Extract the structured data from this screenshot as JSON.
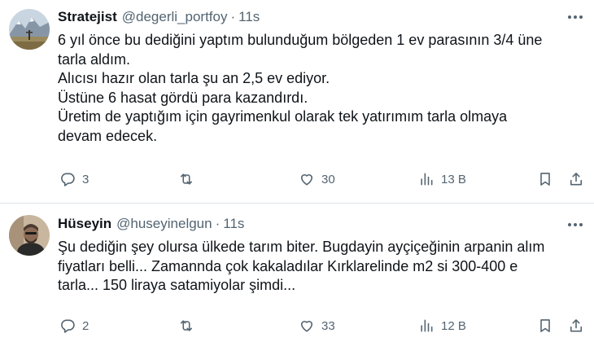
{
  "tweets": [
    {
      "name": "Stratejist",
      "handle": "@degerli_portfoy",
      "separator": "·",
      "time": "11s",
      "lines": [
        "6 yıl önce bu dediğini yaptım bulunduğum bölgeden 1 ev parasının 3/4 üne",
        "tarla aldım.",
        "Alıcısı hazır olan tarla şu an 2,5 ev ediyor.",
        "Üstüne 6 hasat gördü para kazandırdı.",
        "Üretim de yaptığım için gayrimenkul olarak tek yatırımım tarla olmaya",
        "devam edecek."
      ],
      "replies": "3",
      "retweets": "",
      "likes": "30",
      "views": "13 B",
      "avatar_icon": "mountain-landscape-avatar"
    },
    {
      "name": "Hüseyin",
      "handle": "@huseyinelgun",
      "separator": "·",
      "time": "11s",
      "lines": [
        "Şu dediğin şey olursa ülkede tarım biter. Bugdayin ayçiçeğinin arpanin alım",
        "fiyatları belli... Zamannda çok kakaladılar Kırklarelinde m2 si 300-400 e",
        "tarla... 150 liraya satamiyolar şimdi..."
      ],
      "replies": "2",
      "retweets": "",
      "likes": "33",
      "views": "12 B",
      "avatar_icon": "person-photo-avatar"
    }
  ],
  "icons": {
    "reply": "reply-icon",
    "retweet": "retweet-icon",
    "like": "heart-icon",
    "views": "views-chart-icon",
    "bookmark": "bookmark-icon",
    "share": "share-icon",
    "more": "more-dots-icon"
  },
  "colors": {
    "text": "#0f1419",
    "secondary": "#536471",
    "divider": "#e1e6ea",
    "background": "#ffffff"
  }
}
